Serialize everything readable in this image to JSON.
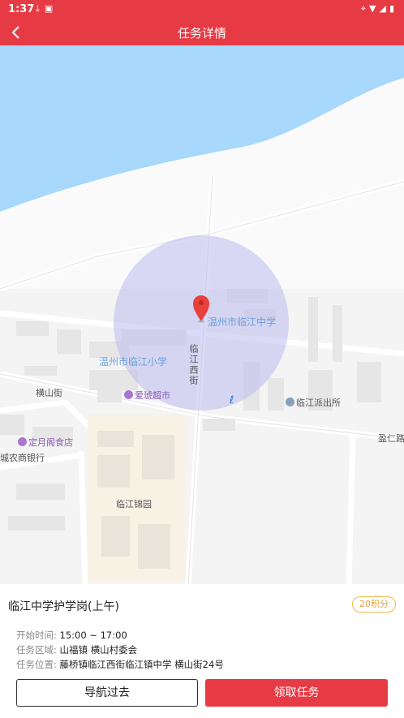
{
  "status_bar": {
    "time": "1:37",
    "left_icons": [
      "download-icon",
      "notification-a-icon"
    ],
    "right_icons": [
      "location-icon",
      "wifi-icon",
      "signal-icon",
      "battery-icon"
    ]
  },
  "nav": {
    "title": "任务详情",
    "back_icon": "chevron-left-icon"
  },
  "map": {
    "labels": {
      "school_main": "温州市临江中学",
      "school_primary": "温州市临江小学",
      "street_xi": "临江西街",
      "street_hengshan": "横山街",
      "supermarket": "爱琥超市",
      "police": "临江派出所",
      "restaurant": "定月阁食店",
      "bank": "城农商银行",
      "garden": "临江锦园",
      "road_right": "盈仁路"
    },
    "colors": {
      "water": "#a8d8fb",
      "radius_circle": "#bcbcf0",
      "marker": "#e8413a"
    }
  },
  "task": {
    "title": "临江中学护学岗(上午)",
    "points": "20积分",
    "start_label": "开始时间:",
    "start_value": "15:00 ~ 17:00",
    "area_label": "任务区域:",
    "area_value": "山福镇 横山村委会",
    "location_label": "任务位置:",
    "location_value": "藤桥镇临江西街临江镇中学 横山街24号"
  },
  "buttons": {
    "navigate": "导航过去",
    "claim": "领取任务"
  },
  "colors": {
    "accent": "#e63b45",
    "badge": "#e9a23b"
  }
}
